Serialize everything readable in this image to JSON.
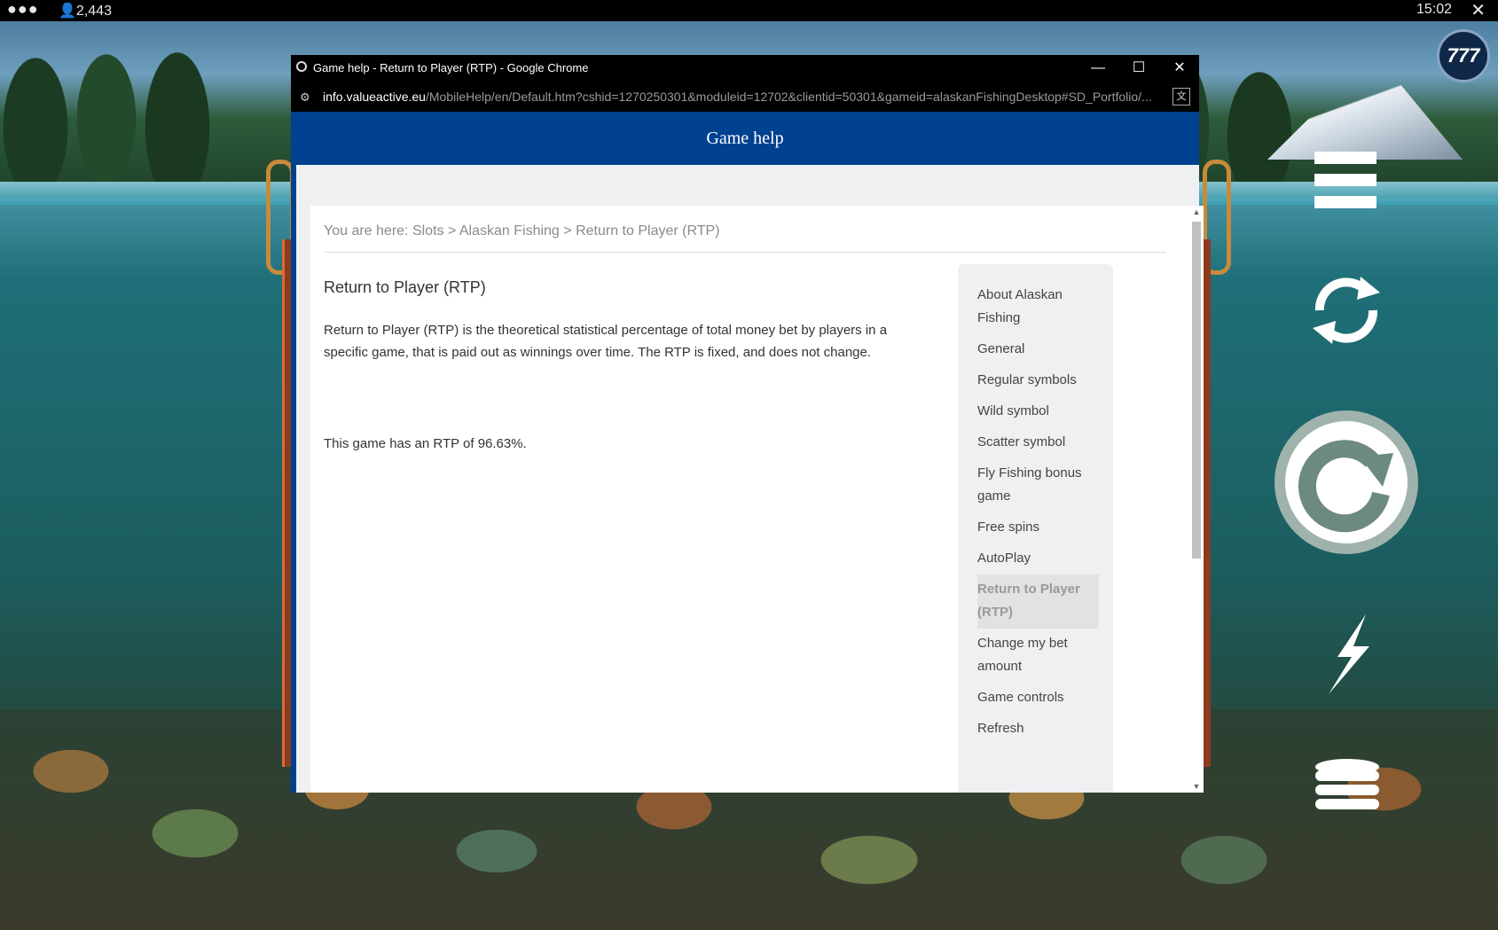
{
  "status_bar": {
    "players": "2,443",
    "clock": "15:02"
  },
  "game": {
    "logo_text": "777"
  },
  "browser": {
    "title": "Game help - Return to Player (RTP) - Google Chrome",
    "url_host": "info.valueactive.eu",
    "url_path": "/MobileHelp/en/Default.htm?cshid=1270250301&moduleid=12702&clientid=50301&gameid=alaskanFishingDesktop#SD_Portfolio/..."
  },
  "help": {
    "header": "Game help",
    "breadcrumb": {
      "prefix": "You are here:",
      "items": [
        "Slots",
        "Alaskan Fishing",
        "Return to Player (RTP)"
      ],
      "separator": ">"
    },
    "heading": "Return to Player (RTP)",
    "paragraph": "Return to Player (RTP) is the theoretical statistical percentage of total money bet by players in a specific game, that is paid out as winnings over time. The RTP is fixed, and does not change.",
    "rtp_text": "This game has an RTP of 96.63%.",
    "nav": [
      "About Alaskan Fishing",
      "General",
      "Regular symbols",
      "Wild symbol",
      "Scatter symbol",
      "Fly Fishing bonus game",
      "Free spins",
      "AutoPlay",
      "Return to Player (RTP)",
      "Change my bet amount",
      "Game controls",
      "Refresh"
    ],
    "active_nav": "Return to Player (RTP)"
  },
  "colors": {
    "header_blue": "#004190",
    "panel_gray": "#eef0f2"
  }
}
